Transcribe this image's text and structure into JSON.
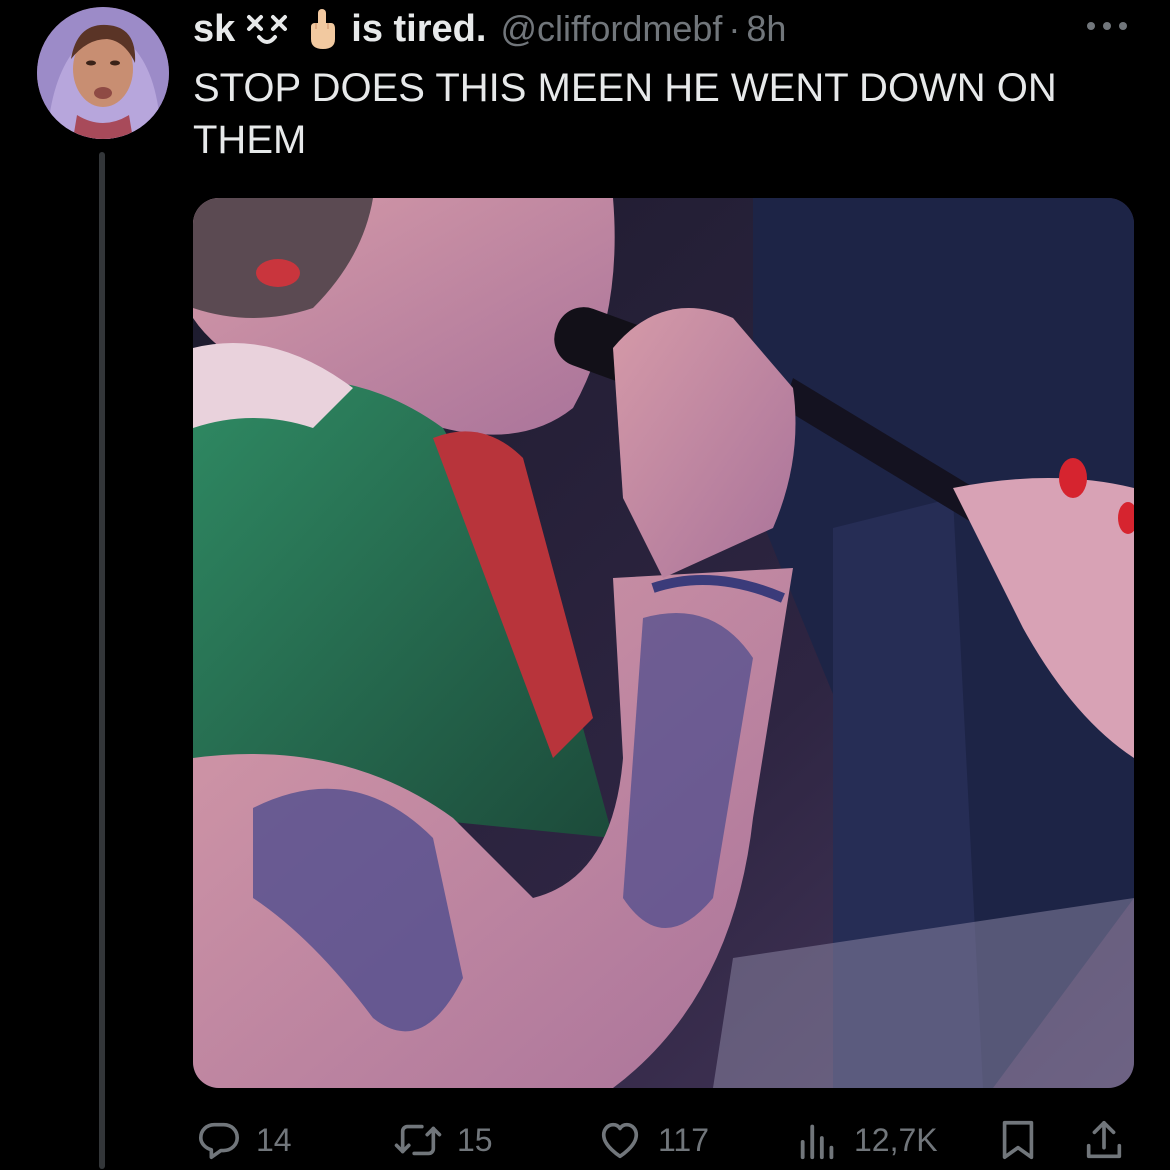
{
  "tweet": {
    "author": {
      "name_start": "sk",
      "name_end": "is tired.",
      "face_emoji": "x-eyes-face-emoji",
      "finger_emoji": "middle-finger-emoji",
      "handle": "@cliffordmebf",
      "separator": "·",
      "time": "8h"
    },
    "text": "STOP DOES THIS MEEN HE WENT DOWN ON THEM",
    "media": {
      "kind": "photo",
      "description_icon": "photo-image"
    },
    "actions": {
      "replies": "14",
      "retweets": "15",
      "likes": "117",
      "views": "12,7K"
    }
  },
  "icons": {
    "more": "more-dots-icon",
    "reply": "reply-icon",
    "retweet": "retweet-icon",
    "like": "heart-icon",
    "views": "views-icon",
    "bookmark": "bookmark-icon",
    "share": "share-icon"
  },
  "colors": {
    "background": "#000000",
    "text_primary": "#e7e9ea",
    "text_secondary": "#71767b",
    "thread_line": "#333639"
  }
}
